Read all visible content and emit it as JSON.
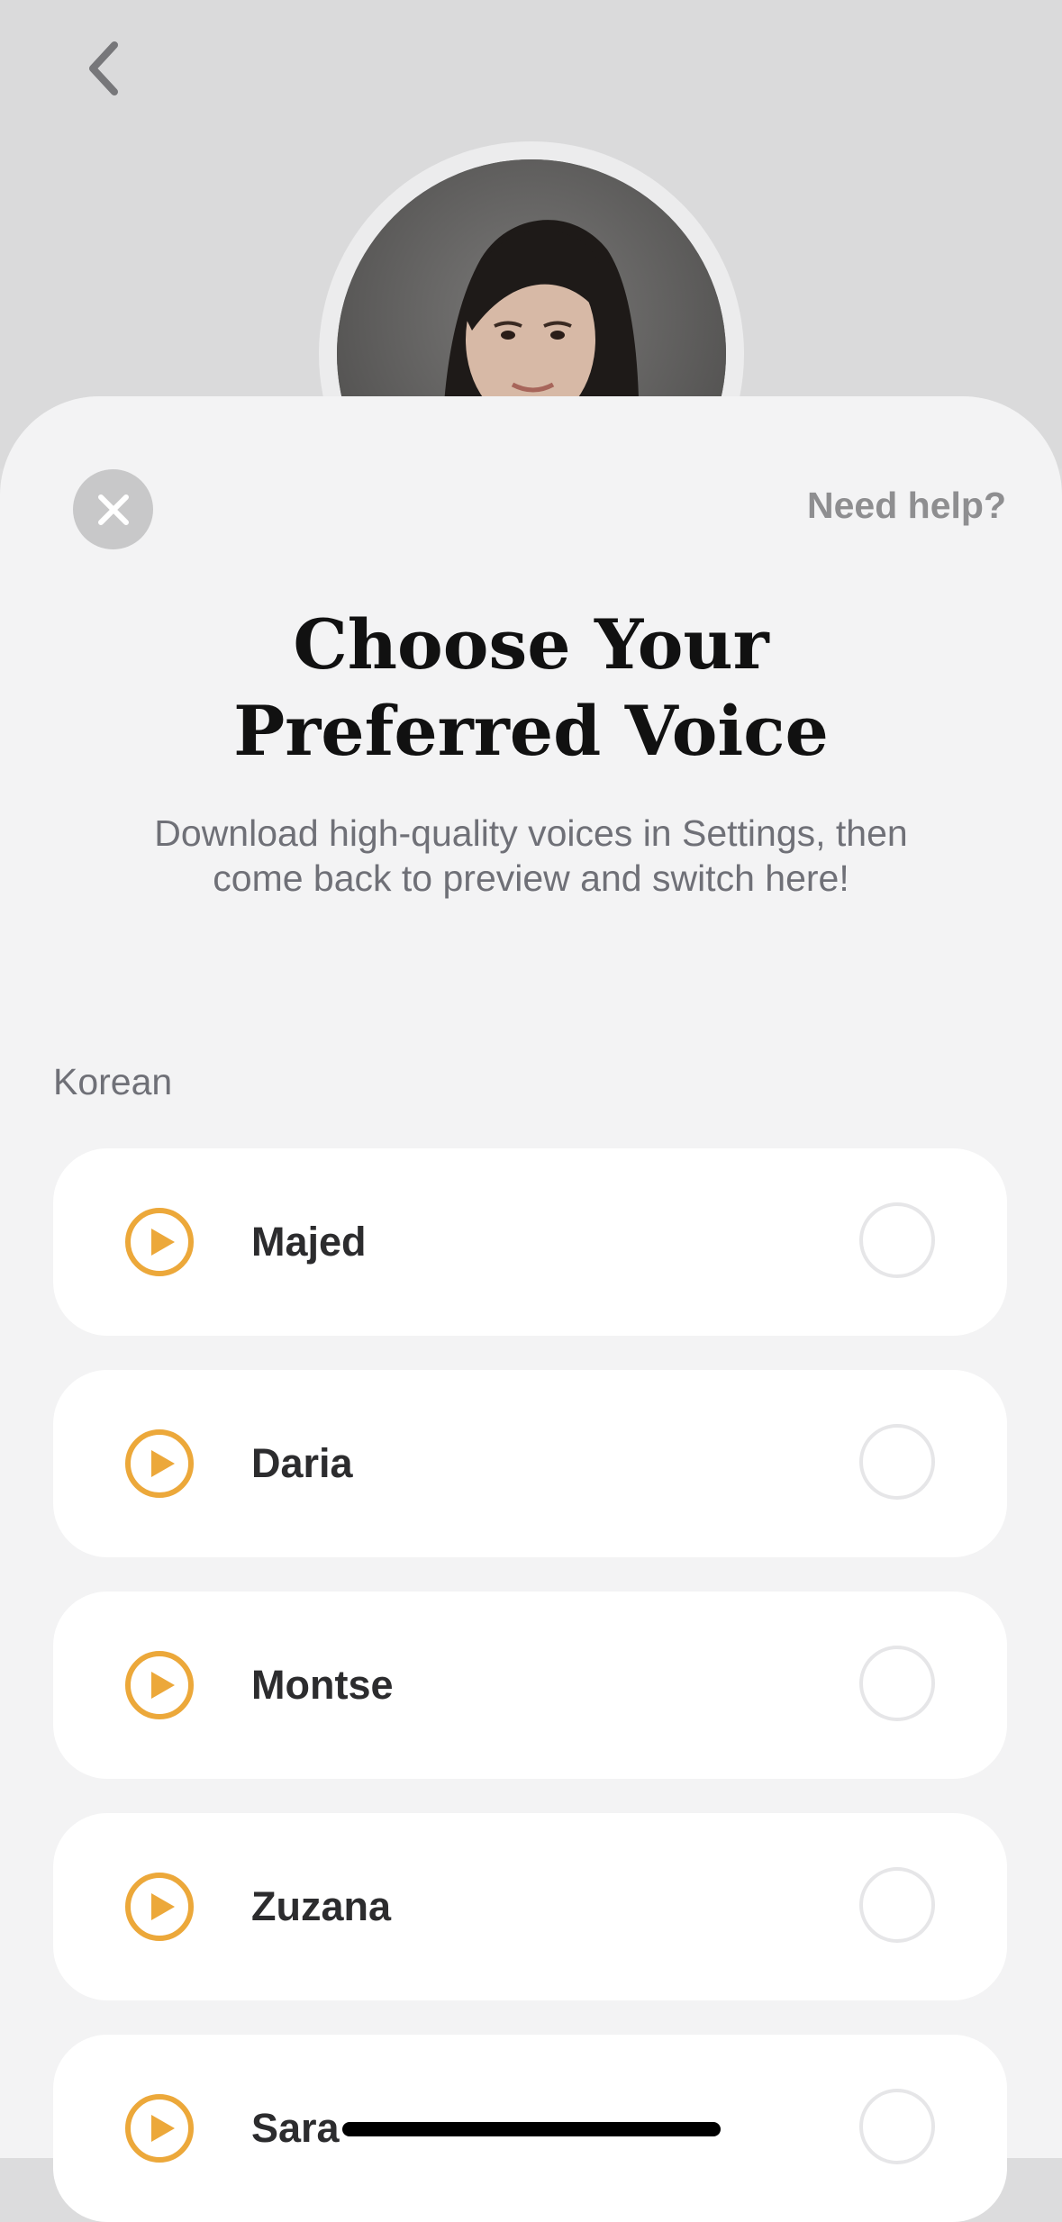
{
  "header": {
    "back_icon": "chevron-left-icon"
  },
  "sheet": {
    "close_icon": "close-icon",
    "help_label": "Need help?",
    "title_line1": "Choose Your",
    "title_line2": "Preferred Voice",
    "subtitle": "Download high-quality voices in Settings, then come back to preview and switch here!",
    "section_label": "Korean"
  },
  "voices": [
    {
      "name": "Majed"
    },
    {
      "name": "Daria"
    },
    {
      "name": "Montse"
    },
    {
      "name": "Zuzana"
    },
    {
      "name": "Sara"
    }
  ],
  "colors": {
    "accent": "#eca83a",
    "sheet_background": "#f3f3f4",
    "card_background": "#ffffff"
  }
}
